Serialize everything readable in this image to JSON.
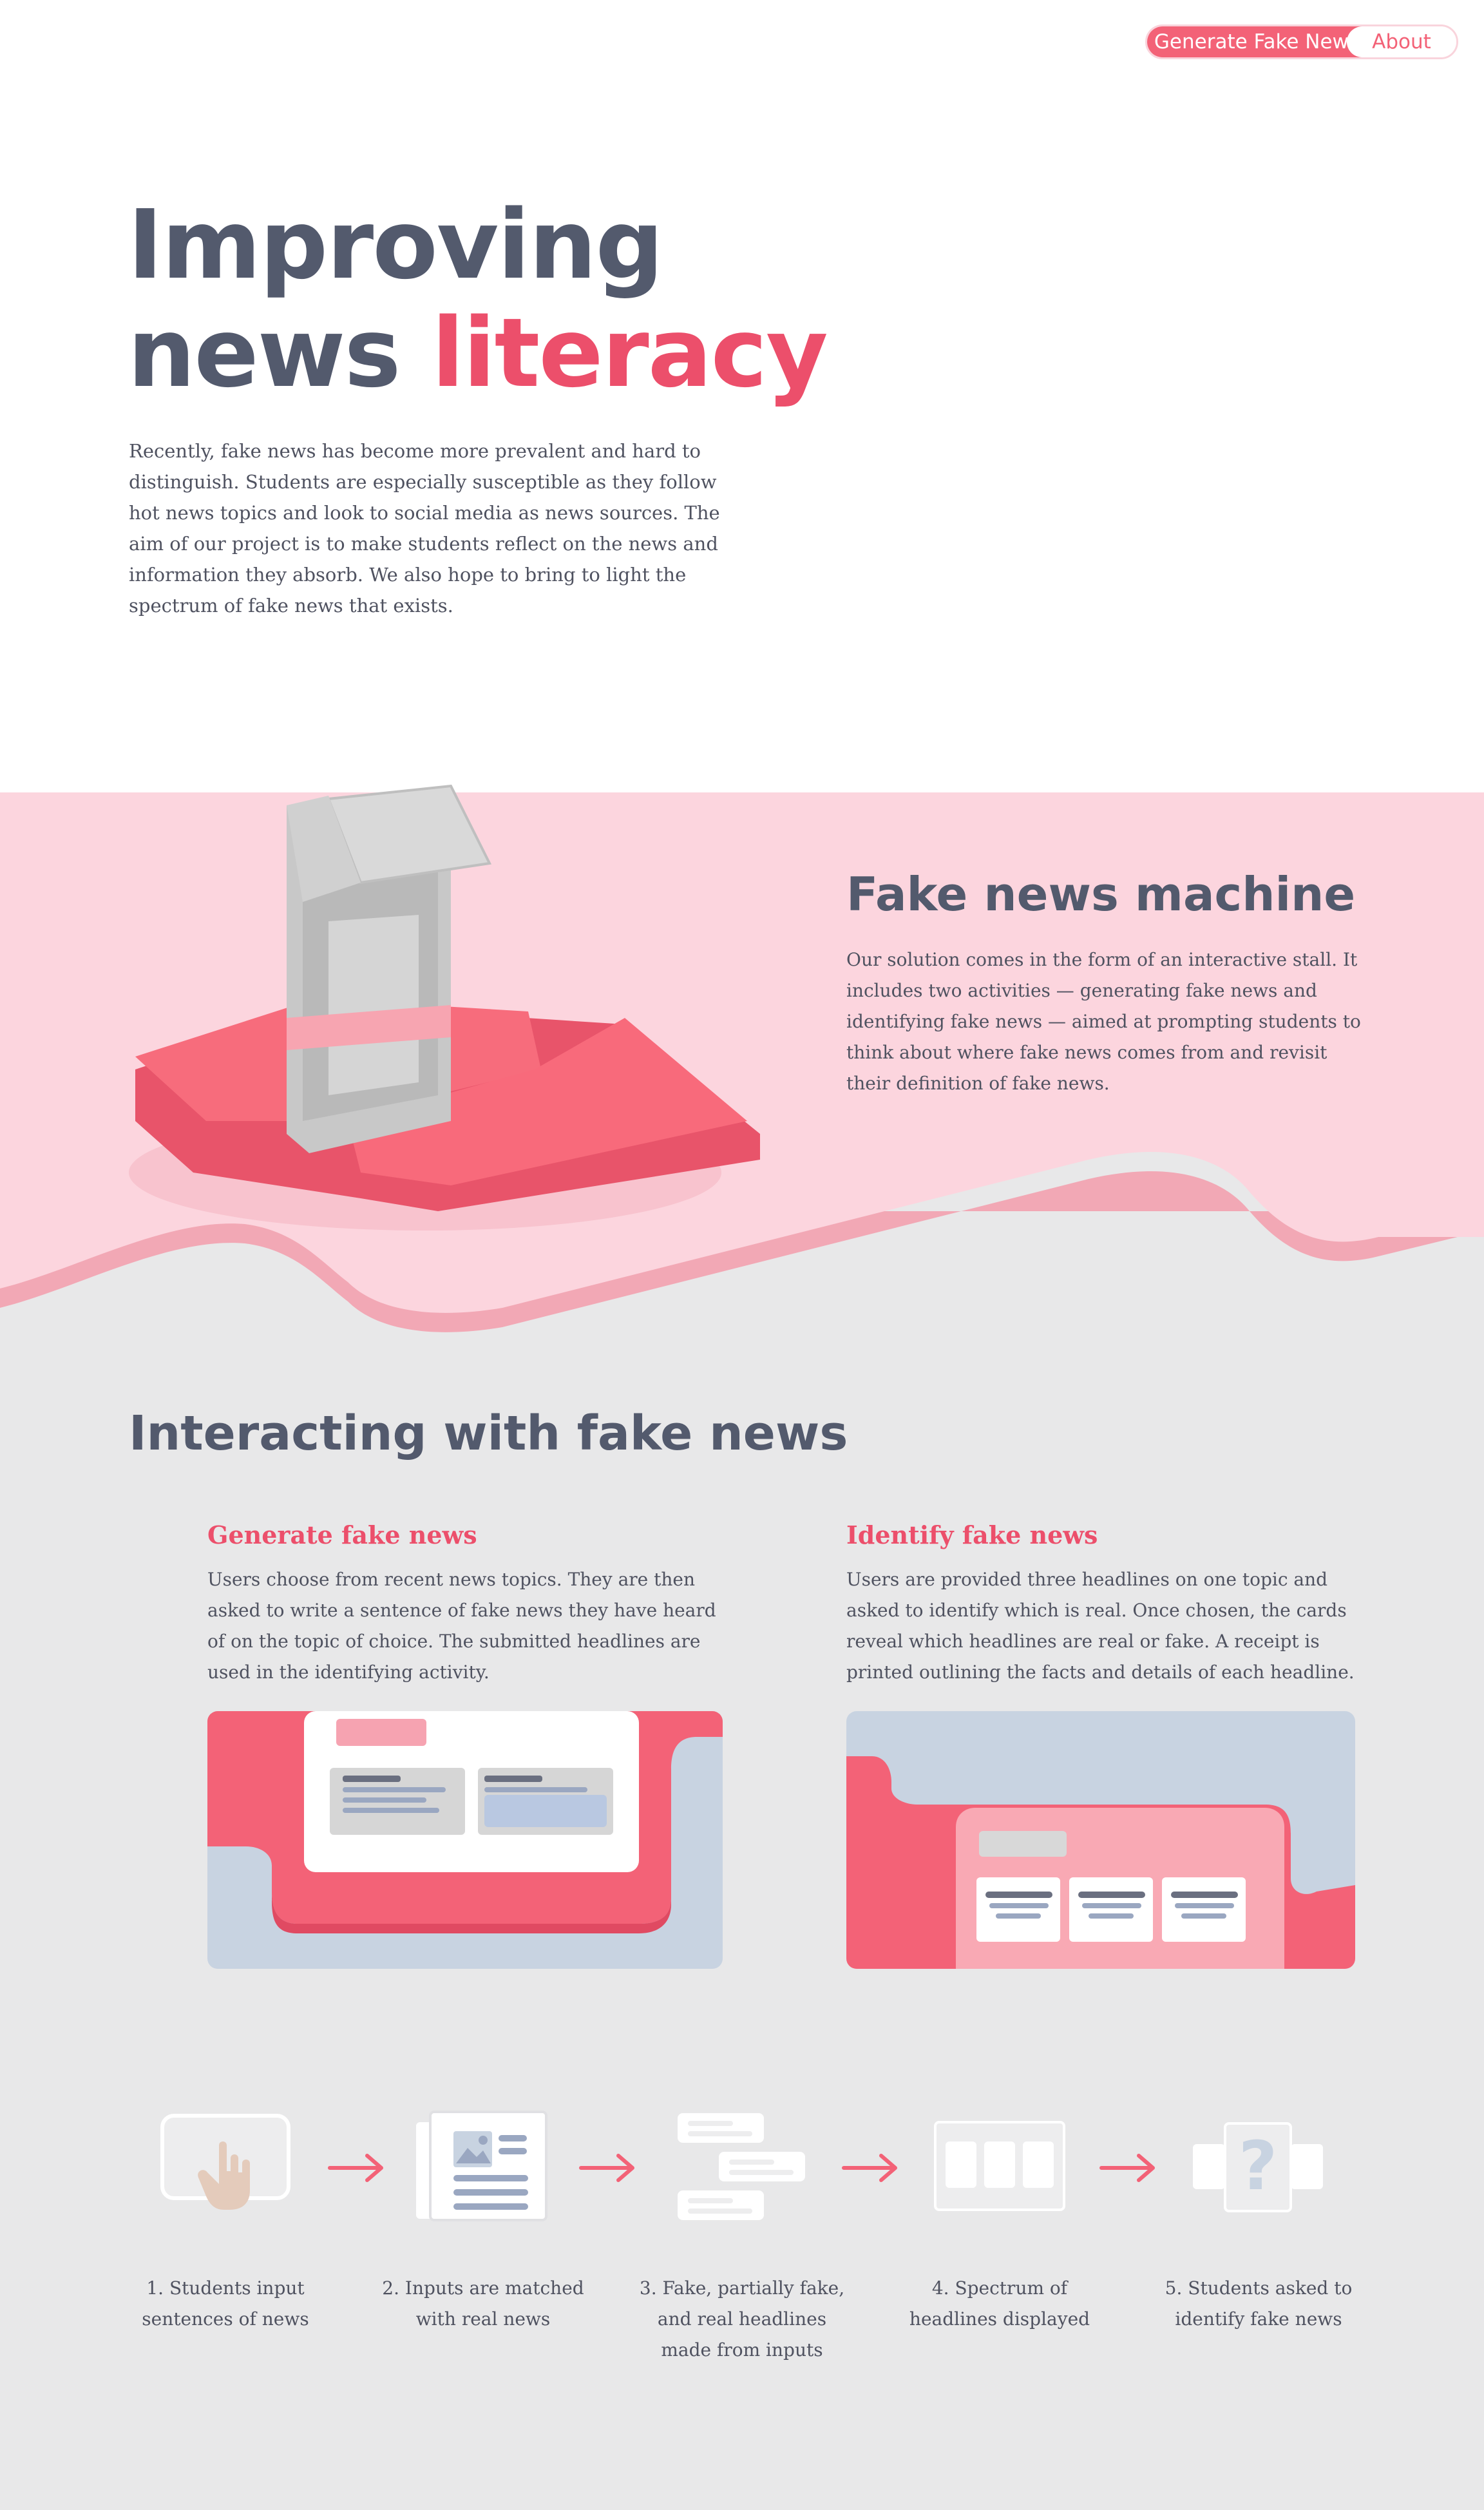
{
  "nav": {
    "generate_label": "Generate Fake News",
    "about_label": "About"
  },
  "hero": {
    "title_line1": "Improving",
    "title_line2_plain": "news",
    "title_line2_accent": "literacy",
    "body": "Recently, fake news has become more prevalent and hard to distinguish. Students are especially susceptible as they follow hot news topics and look to social media as news sources. The aim of our project is to make students reflect on the news and information they absorb. We also hope to bring to light the spectrum of fake news that exists."
  },
  "machine": {
    "title": "Fake news machine",
    "body": "Our solution comes in the form of an interactive stall. It includes two activities — generating fake news and identifying fake news — aimed at prompting students to think about where fake news comes from and revisit their definition of fake news."
  },
  "interacting": {
    "title": "Interacting with fake news",
    "generate": {
      "title": "Generate fake news",
      "body": "Users choose from recent news topics. They are then asked to write a sentence of fake news they have heard of on the topic of choice. The submitted headlines are used in the identifying activity."
    },
    "identify": {
      "title": "Identify fake news",
      "body": "Users are provided three headlines on one topic and asked to identify which is real. Once chosen, the cards reveal which headlines are real or fake. A receipt is printed outlining the facts and details of each headline."
    }
  },
  "steps": [
    {
      "label": "1. Students input sentences of news",
      "icon": "hand-pointer-icon"
    },
    {
      "label": "2. Inputs are matched with real news",
      "icon": "news-article-icon"
    },
    {
      "label": "3. Fake, partially fake, and real headlines made from inputs",
      "icon": "headlines-icon"
    },
    {
      "label": "4. Spectrum of headlines displayed",
      "icon": "cards-icon"
    },
    {
      "label": "5. Students asked to identify fake news",
      "icon": "question-card-icon"
    }
  ],
  "colors": {
    "accent": "#ec4f6b",
    "slate": "#535a6d",
    "band_pink": "#fcd5de",
    "coral": "#f36277",
    "gray_bg": "#e8e8e9",
    "card_blue": "#c8d3e1"
  }
}
